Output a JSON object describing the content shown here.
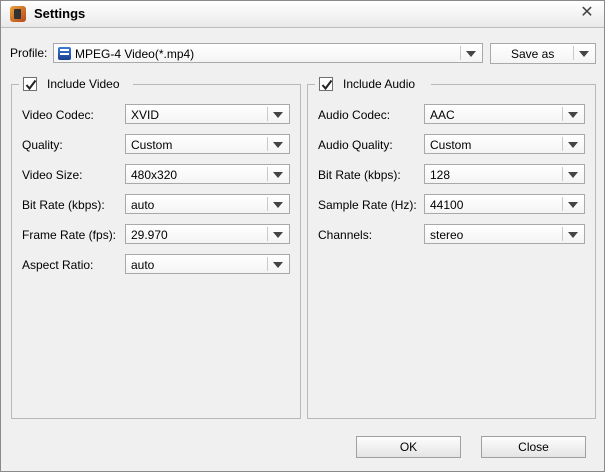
{
  "window": {
    "title": "Settings"
  },
  "profile": {
    "label": "Profile:",
    "value": "MPEG-4 Video(*.mp4)",
    "save_as": "Save as"
  },
  "video": {
    "group_label": "Include Video",
    "include_checked": true,
    "rows": [
      {
        "label": "Video Codec:",
        "value": "XVID"
      },
      {
        "label": "Quality:",
        "value": "Custom"
      },
      {
        "label": "Video Size:",
        "value": "480x320"
      },
      {
        "label": "Bit Rate (kbps):",
        "value": "auto"
      },
      {
        "label": "Frame Rate (fps):",
        "value": "29.970"
      },
      {
        "label": "Aspect Ratio:",
        "value": "auto"
      }
    ]
  },
  "audio": {
    "group_label": "Include Audio",
    "include_checked": true,
    "rows": [
      {
        "label": "Audio Codec:",
        "value": "AAC"
      },
      {
        "label": "Audio Quality:",
        "value": "Custom"
      },
      {
        "label": "Bit Rate (kbps):",
        "value": "128"
      },
      {
        "label": "Sample Rate (Hz):",
        "value": "44100"
      },
      {
        "label": "Channels:",
        "value": "stereo"
      }
    ]
  },
  "footer": {
    "ok": "OK",
    "close": "Close"
  },
  "icons": {
    "close": "close-icon",
    "app": "app-icon",
    "dropdown": "chevron-down-icon",
    "checkbox": "checkmark-icon"
  }
}
